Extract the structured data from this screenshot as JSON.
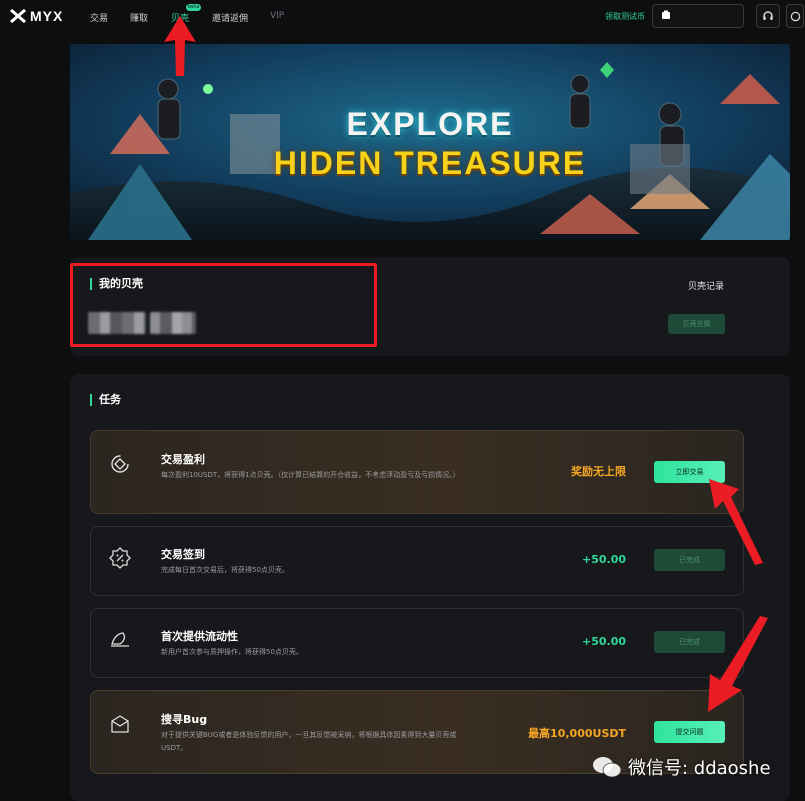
{
  "nav": {
    "logo_text": "MYX",
    "items": [
      "交易",
      "赚取",
      "贝壳",
      "邀请返佣",
      "VIP"
    ],
    "beta_badge": "beta",
    "claim_test_tokens": "领取测试币"
  },
  "banner": {
    "line1": "EXPLORE",
    "line2": "HIDEN TREASURE"
  },
  "shells": {
    "title": "我的贝壳",
    "record_link": "贝壳记录",
    "share_button": "贝壳兑换"
  },
  "tasks": {
    "title": "任务",
    "items": [
      {
        "title": "交易盈利",
        "desc": "每次盈利10USDT，将获得1点贝壳。（仅计算已结算的开仓收益，不考虑浮动盈亏及亏损情况。）",
        "reward": "奖励无上限",
        "button": "立即交易",
        "icon": "trade-profit-icon",
        "status": "active"
      },
      {
        "title": "交易签到",
        "desc": "完成每日首次交易后，将获得50点贝壳。",
        "reward": "+50.00",
        "button": "已完成",
        "icon": "percent-badge-icon",
        "status": "done"
      },
      {
        "title": "首次提供流动性",
        "desc": "新用户首次参与质押操作，将获得50点贝壳。",
        "reward": "+50.00",
        "button": "已完成",
        "icon": "liquidity-icon",
        "status": "done"
      },
      {
        "title": "搜寻Bug",
        "desc": "对于提供关键BUG或者是体验反馈的用户，一旦其反馈被采纳，将根据具体因素得到大量贝壳或USDT。",
        "reward": "最高10,000USDT",
        "button": "提交问题",
        "icon": "bug-report-icon",
        "status": "active"
      }
    ]
  },
  "watermark": "微信号: ddaoshe",
  "colors": {
    "accent_green": "#2fd89a",
    "reward_orange": "#f5a623",
    "annotation_red": "#ec1c24",
    "background": "#0d0e10",
    "card": "#16181b"
  }
}
